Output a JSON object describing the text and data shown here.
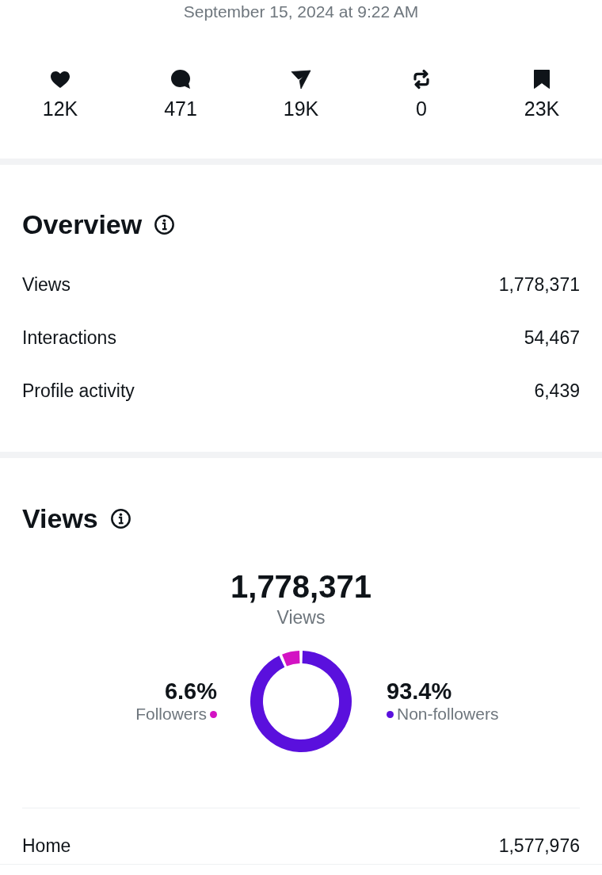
{
  "timestamp": "September 15, 2024 at 9:22 AM",
  "stats": [
    {
      "kind": "likes",
      "value": "12K"
    },
    {
      "kind": "replies",
      "value": "471"
    },
    {
      "kind": "shares",
      "value": "19K"
    },
    {
      "kind": "reposts",
      "value": "0"
    },
    {
      "kind": "bookmarks",
      "value": "23K"
    }
  ],
  "overview": {
    "title": "Overview",
    "rows": [
      {
        "label": "Views",
        "value": "1,778,371"
      },
      {
        "label": "Interactions",
        "value": "54,467"
      },
      {
        "label": "Profile activity",
        "value": "6,439"
      }
    ]
  },
  "views": {
    "title": "Views",
    "total": "1,778,371",
    "total_label": "Views",
    "legend": [
      {
        "percent": "6.6%",
        "color": "#d313c3"
      },
      {
        "percent": "93.4%",
        "color": "#5a10dd"
      }
    ],
    "chart_data": {
      "type": "donut",
      "categories": [
        "Followers",
        "Non-followers"
      ],
      "values": [
        6.6,
        93.4
      ]
    },
    "rows": [
      {
        "label": "Home",
        "value": "1,577,976"
      }
    ]
  }
}
